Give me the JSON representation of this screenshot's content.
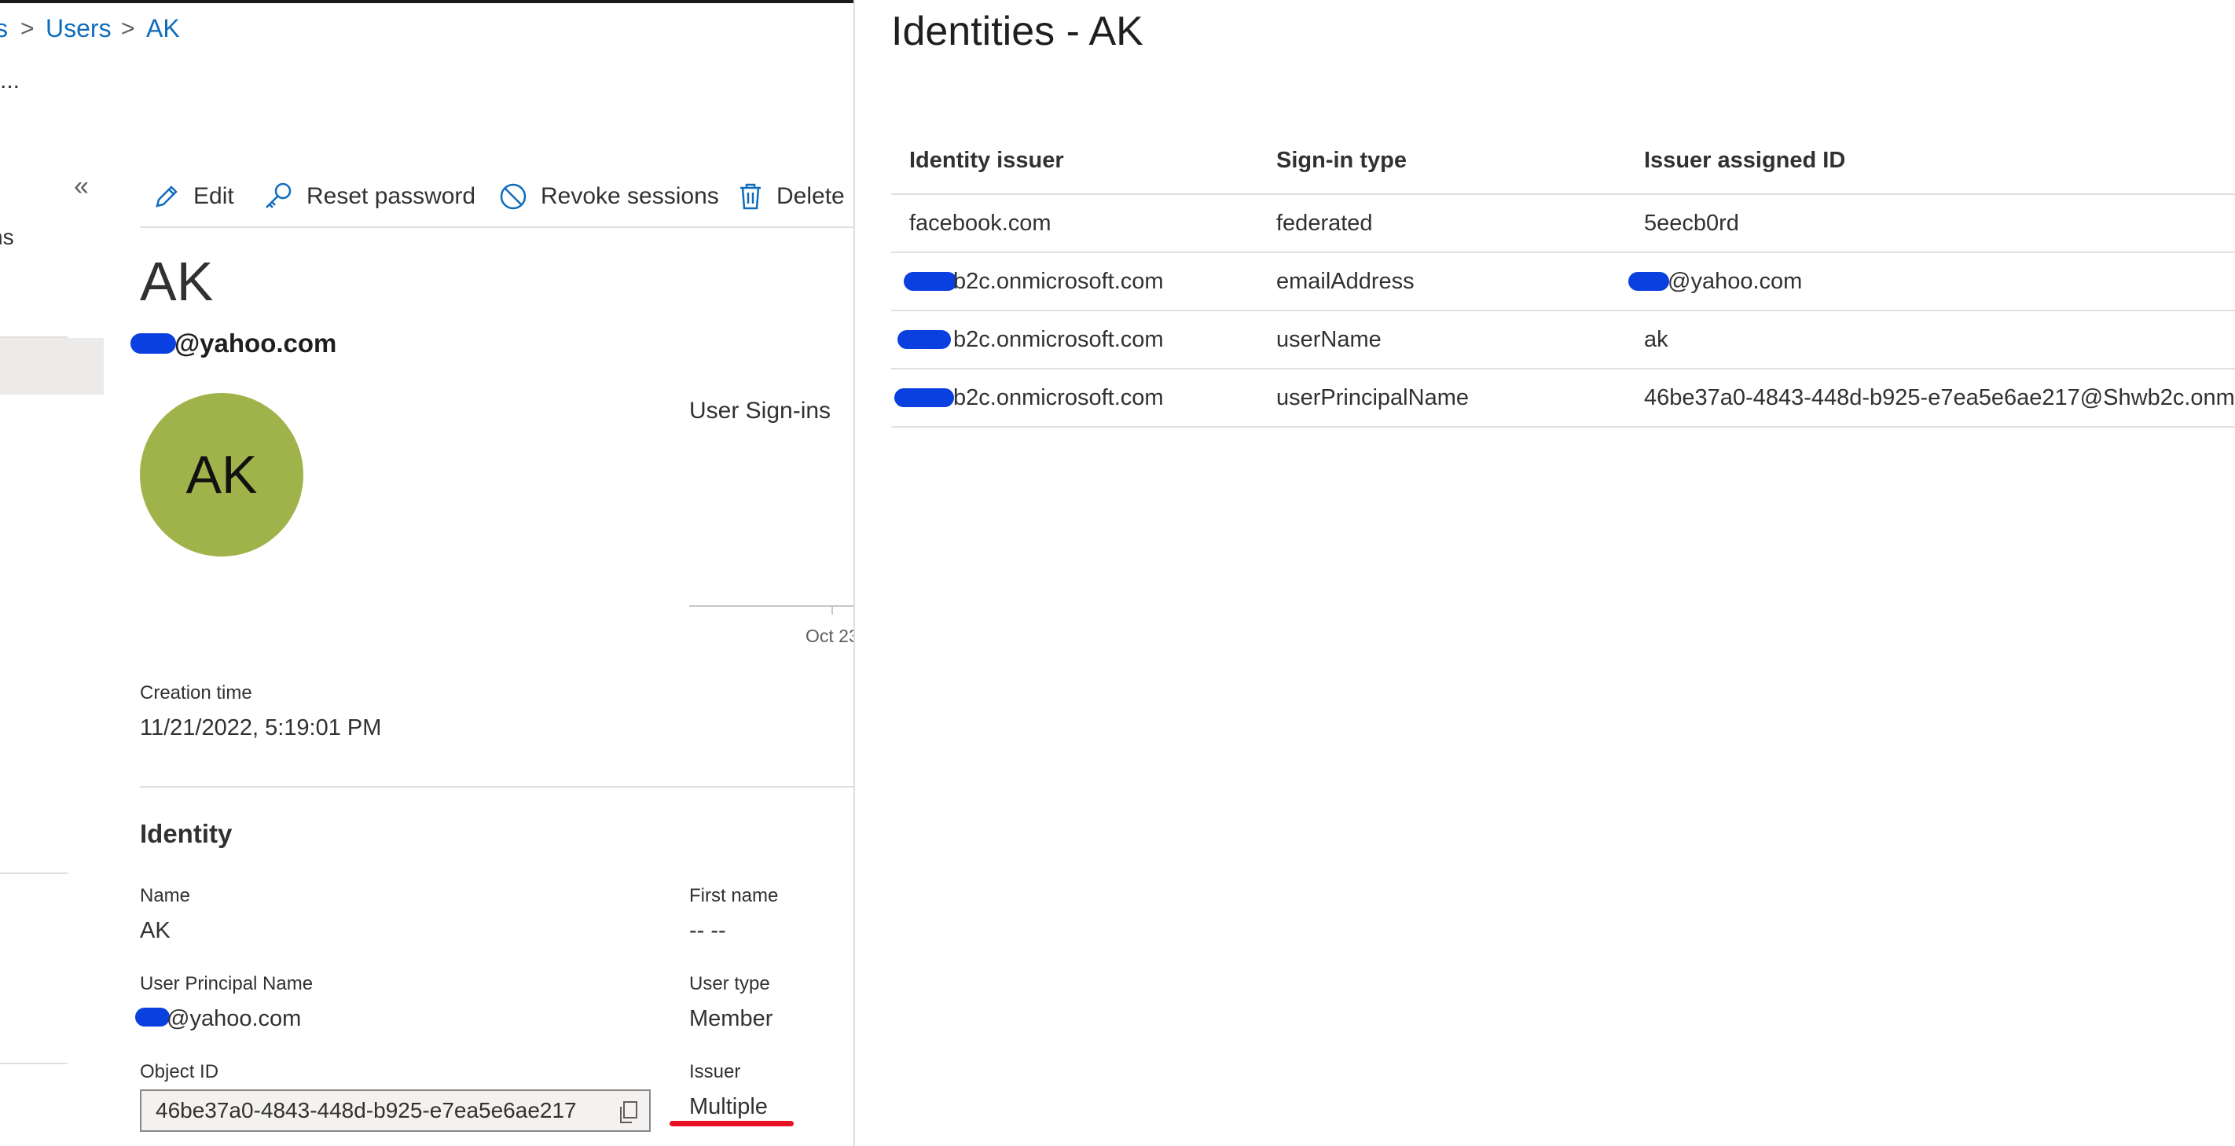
{
  "breadcrumb": {
    "partial": "s",
    "users": "Users",
    "current": "AK",
    "sep": ">"
  },
  "nav": {
    "ellipsis": "...",
    "collapse": "«",
    "partial_item": "ns"
  },
  "toolbar": {
    "edit": "Edit",
    "reset_password": "Reset password",
    "revoke_sessions": "Revoke sessions",
    "delete": "Delete"
  },
  "user": {
    "name": "AK",
    "email_suffix": "@yahoo.com",
    "initials": "AK"
  },
  "signins": {
    "link": "User Sign-ins",
    "axis_label": "Oct 23"
  },
  "creation": {
    "label": "Creation time",
    "value": "11/21/2022, 5:19:01 PM"
  },
  "identity": {
    "title": "Identity",
    "name_label": "Name",
    "name_value": "AK",
    "first_name_label": "First name",
    "first_name_value": "-- --",
    "upn_label": "User Principal Name",
    "upn_suffix": "@yahoo.com",
    "user_type_label": "User type",
    "user_type_value": "Member",
    "object_id_label": "Object ID",
    "object_id_value": "46be37a0-4843-448d-b925-e7ea5e6ae217",
    "issuer_label": "Issuer",
    "issuer_value": "Multiple"
  },
  "panel": {
    "title": "Identities - AK",
    "headers": [
      "Identity issuer",
      "Sign-in type",
      "Issuer assigned ID"
    ],
    "rows": [
      {
        "issuer": "facebook.com",
        "type": "federated",
        "id": "5eecb0rd"
      },
      {
        "issuer": "b2c.onmicrosoft.com",
        "type": "emailAddress",
        "id": "@yahoo.com"
      },
      {
        "issuer": "b2c.onmicrosoft.com",
        "type": "userName",
        "id": "ak"
      },
      {
        "issuer": "b2c.onmicrosoft.com",
        "type": "userPrincipalName",
        "id": "46be37a0-4843-448d-b925-e7ea5e6ae217@Shwb2c.onm"
      }
    ]
  },
  "colors": {
    "accent": "#0f6cbd",
    "avatar": "#9fb34a",
    "redaction": "#0a3fe0",
    "highlight": "#e81123"
  }
}
